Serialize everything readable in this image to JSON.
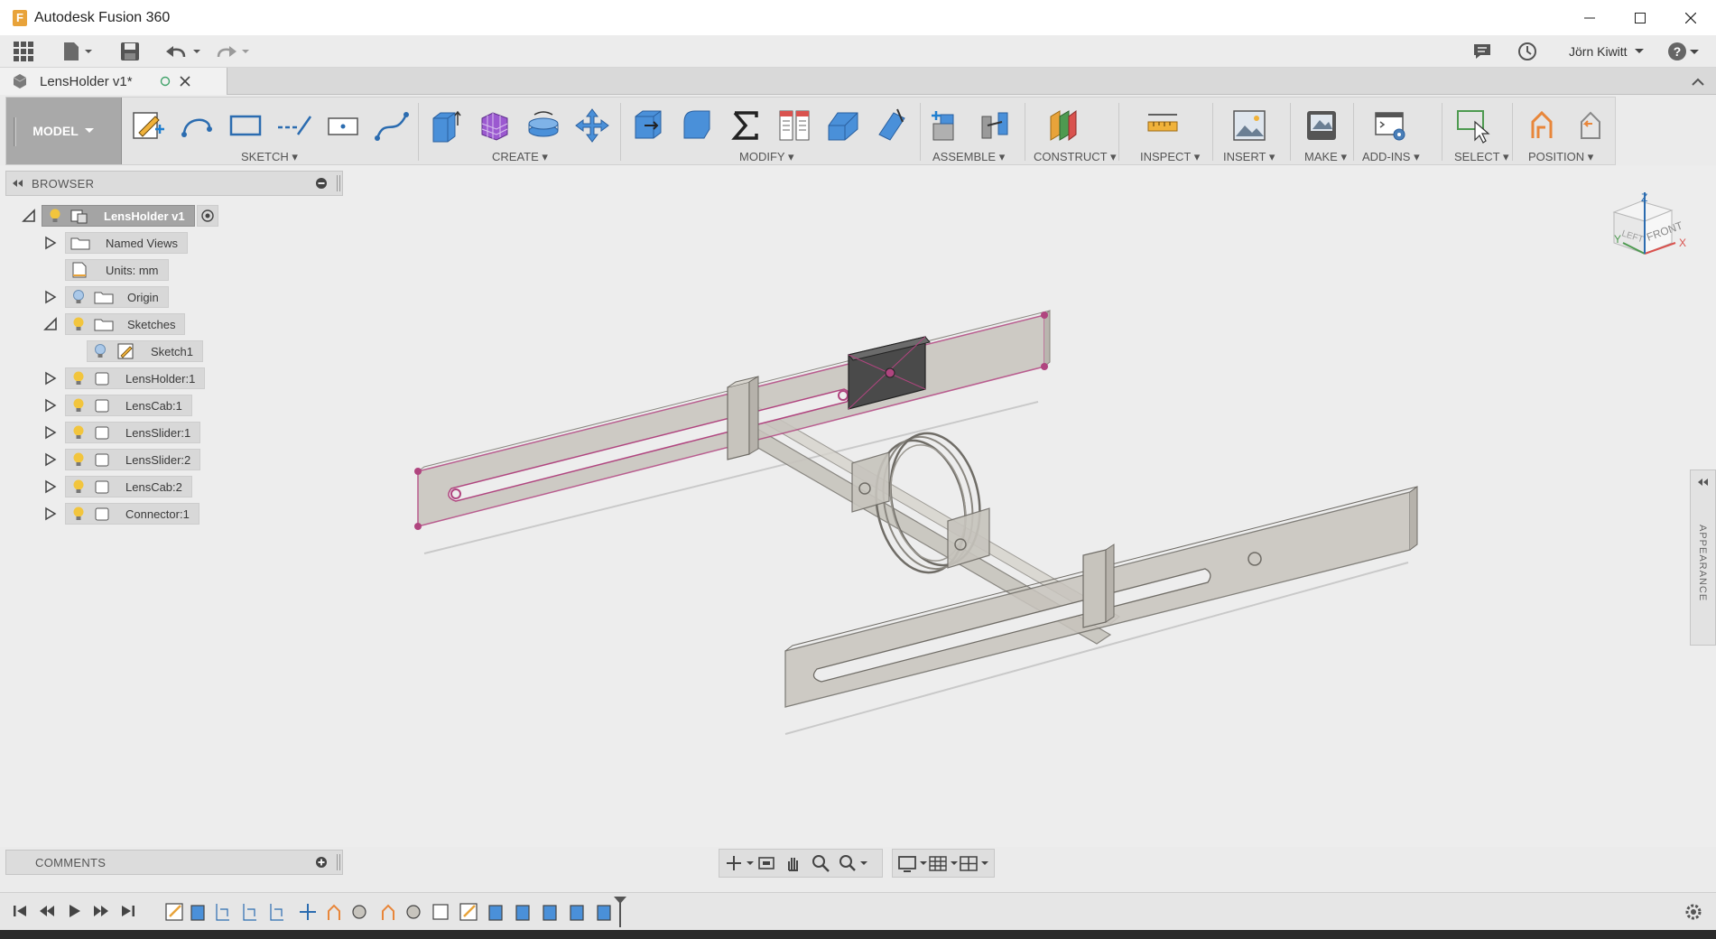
{
  "window": {
    "title": "Autodesk Fusion 360",
    "logo_letter": "F"
  },
  "quick_access": {
    "user": "Jörn Kiwitt"
  },
  "document_tab": {
    "label": "LensHolder v1*"
  },
  "ribbon": {
    "workspace": "MODEL",
    "groups": [
      "SKETCH",
      "CREATE",
      "MODIFY",
      "ASSEMBLE",
      "CONSTRUCT",
      "INSPECT",
      "INSERT",
      "MAKE",
      "ADD-INS",
      "SELECT",
      "POSITION"
    ]
  },
  "browser": {
    "title": "BROWSER",
    "root": "LensHolder v1",
    "items": [
      {
        "label": "Named Views"
      },
      {
        "label": "Units: mm"
      },
      {
        "label": "Origin"
      },
      {
        "label": "Sketches"
      },
      {
        "label": "Sketch1"
      },
      {
        "label": "LensHolder:1"
      },
      {
        "label": "LensCab:1"
      },
      {
        "label": "LensSlider:1"
      },
      {
        "label": "LensSlider:2"
      },
      {
        "label": "LensCab:2"
      },
      {
        "label": "Connector:1"
      }
    ]
  },
  "comments": {
    "title": "COMMENTS"
  },
  "appearance": {
    "label": "APPEARANCE"
  },
  "viewcube": {
    "left": "LEFT",
    "front": "FRONT",
    "x": "X",
    "y": "Y",
    "z": "Z"
  },
  "colors": {
    "accent_sketch": "#b0457f",
    "model_body": "#b7b4ad",
    "ribbon_bg": "#e4e4e4"
  }
}
